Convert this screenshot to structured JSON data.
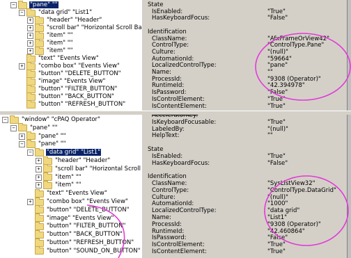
{
  "top_tree": {
    "rows": [
      {
        "indent": 1,
        "exp": "-",
        "label": "\"pane\" \"\"",
        "selected": true
      },
      {
        "indent": 2,
        "exp": "-",
        "label": "\"data grid\" \"List1\""
      },
      {
        "indent": 3,
        "exp": "+",
        "label": "\"header\" \"Header\""
      },
      {
        "indent": 3,
        "exp": "+",
        "label": "\"scroll bar\" \"Horizontal Scroll Bar\""
      },
      {
        "indent": 3,
        "exp": "+",
        "label": "\"item\" \"\""
      },
      {
        "indent": 3,
        "exp": "+",
        "label": "\"item\" \"\""
      },
      {
        "indent": 3,
        "exp": "+",
        "label": "\"item\" \"\""
      },
      {
        "indent": 2,
        "exp": "",
        "label": "\"text\" \"Events View\""
      },
      {
        "indent": 2,
        "exp": "+",
        "label": "\"combo box\" \"Events View\""
      },
      {
        "indent": 2,
        "exp": "",
        "label": "\"button\" \"DELETE_BUTTON\""
      },
      {
        "indent": 2,
        "exp": "",
        "label": "\"image\" \"Events View\""
      },
      {
        "indent": 2,
        "exp": "",
        "label": "\"button\" \"FILTER_BUTTON\""
      },
      {
        "indent": 2,
        "exp": "",
        "label": "\"button\" \"BACK_BUTTON\""
      },
      {
        "indent": 2,
        "exp": "",
        "label": "\"button\" \"REFRESH_BUTTON\""
      }
    ]
  },
  "top_props": {
    "rows": [
      {
        "k": "State",
        "v": "",
        "type": "head"
      },
      {
        "k": "IsEnabled:",
        "v": "\"True\"",
        "type": "sub"
      },
      {
        "k": "HasKeyboardFocus:",
        "v": "\"False\"",
        "type": "sub"
      },
      {
        "k": "",
        "v": "",
        "type": "blank"
      },
      {
        "k": "Identification",
        "v": "",
        "type": "head"
      },
      {
        "k": "ClassName:",
        "v": "\"AfxFrameOrView42\"",
        "type": "sub"
      },
      {
        "k": "ControlType:",
        "v": "\"ControlType.Pane\"",
        "type": "sub"
      },
      {
        "k": "Culture:",
        "v": "\"(null)\"",
        "type": "sub"
      },
      {
        "k": "AutomationId:",
        "v": "\"59664\"",
        "type": "sub"
      },
      {
        "k": "LocalizedControlType:",
        "v": "\"pane\"",
        "type": "sub"
      },
      {
        "k": "Name:",
        "v": "\"\"",
        "type": "sub"
      },
      {
        "k": "ProcessId:",
        "v": "\"9308 (Operator)\"",
        "type": "sub"
      },
      {
        "k": "RuntimeId:",
        "v": "\"42.394978\"",
        "type": "sub"
      },
      {
        "k": "IsPassword:",
        "v": "\"False\"",
        "type": "sub"
      },
      {
        "k": "IsControlElement:",
        "v": "\"True\"",
        "type": "sub"
      },
      {
        "k": "IsContentElement:",
        "v": "\"True\"",
        "type": "sub"
      }
    ]
  },
  "bottom_tree": {
    "rows": [
      {
        "indent": 0,
        "exp": "-",
        "label": "\"window\" \"cPAQ Operator\""
      },
      {
        "indent": 1,
        "exp": "-",
        "label": "\"pane\" \"\""
      },
      {
        "indent": 2,
        "exp": "+",
        "label": "\"pane\" \"\""
      },
      {
        "indent": 2,
        "exp": "-",
        "label": "\"pane\" \"\""
      },
      {
        "indent": 3,
        "exp": "-",
        "label": "\"data grid\" \"List1\"",
        "selected": true
      },
      {
        "indent": 4,
        "exp": "+",
        "label": "\"header\" \"Header\""
      },
      {
        "indent": 4,
        "exp": "+",
        "label": "\"scroll bar\" \"Horizontal Scroll Bar\""
      },
      {
        "indent": 4,
        "exp": "+",
        "label": "\"item\" \"\""
      },
      {
        "indent": 4,
        "exp": "+",
        "label": "\"item\" \"\""
      },
      {
        "indent": 3,
        "exp": "",
        "label": "\"text\" \"Events View\""
      },
      {
        "indent": 3,
        "exp": "+",
        "label": "\"combo box\" \"Events View\""
      },
      {
        "indent": 3,
        "exp": "",
        "label": "\"button\" \"DELETE_BUTTON\""
      },
      {
        "indent": 3,
        "exp": "",
        "label": "\"image\" \"Events View\""
      },
      {
        "indent": 3,
        "exp": "",
        "label": "\"button\" \"FILTER_BUTTON\""
      },
      {
        "indent": 3,
        "exp": "",
        "label": "\"button\" \"BACK_BUTTON\""
      },
      {
        "indent": 3,
        "exp": "",
        "label": "\"button\" \"REFRESH_BUTTON\""
      },
      {
        "indent": 3,
        "exp": "",
        "label": "\"button\" \"SOUND_ON_BUTTON\""
      }
    ]
  },
  "bottom_props": {
    "rows": [
      {
        "k": "AcceleratorKey:",
        "v": "",
        "type": "sub",
        "struck": true
      },
      {
        "k": "IsKeyboardFocusable:",
        "v": "\"True\"",
        "type": "sub"
      },
      {
        "k": "LabeledBy:",
        "v": "\"(null)\"",
        "type": "sub"
      },
      {
        "k": "HelpText:",
        "v": "\"\"",
        "type": "sub"
      },
      {
        "k": "",
        "v": "",
        "type": "blank"
      },
      {
        "k": "State",
        "v": "",
        "type": "head"
      },
      {
        "k": "IsEnabled:",
        "v": "\"True\"",
        "type": "sub"
      },
      {
        "k": "HasKeyboardFocus:",
        "v": "\"False\"",
        "type": "sub"
      },
      {
        "k": "",
        "v": "",
        "type": "blank"
      },
      {
        "k": "Identification",
        "v": "",
        "type": "head"
      },
      {
        "k": "ClassName:",
        "v": "\"SysListView32\"",
        "type": "sub"
      },
      {
        "k": "ControlType:",
        "v": "\"ControlType.DataGrid\"",
        "type": "sub"
      },
      {
        "k": "Culture:",
        "v": "\"(null)\"",
        "type": "sub"
      },
      {
        "k": "AutomationId:",
        "v": "\"1000\"",
        "type": "sub"
      },
      {
        "k": "LocalizedControlType:",
        "v": "\"data grid\"",
        "type": "sub"
      },
      {
        "k": "Name:",
        "v": "\"List1\"",
        "type": "sub"
      },
      {
        "k": "ProcessId:",
        "v": "\"9308 (Operator)\"",
        "type": "sub"
      },
      {
        "k": "RuntimeId:",
        "v": "\"42.460864\"",
        "type": "sub"
      },
      {
        "k": "IsPassword:",
        "v": "\"False\"",
        "type": "sub"
      },
      {
        "k": "IsControlElement:",
        "v": "\"True\"",
        "type": "sub"
      },
      {
        "k": "IsContentElement:",
        "v": "\"True\"",
        "type": "sub"
      }
    ]
  },
  "colors": {
    "annotation_ink": "#e23ad8",
    "selection": "#0a246a",
    "panel_bg": "#d4d0c8"
  }
}
